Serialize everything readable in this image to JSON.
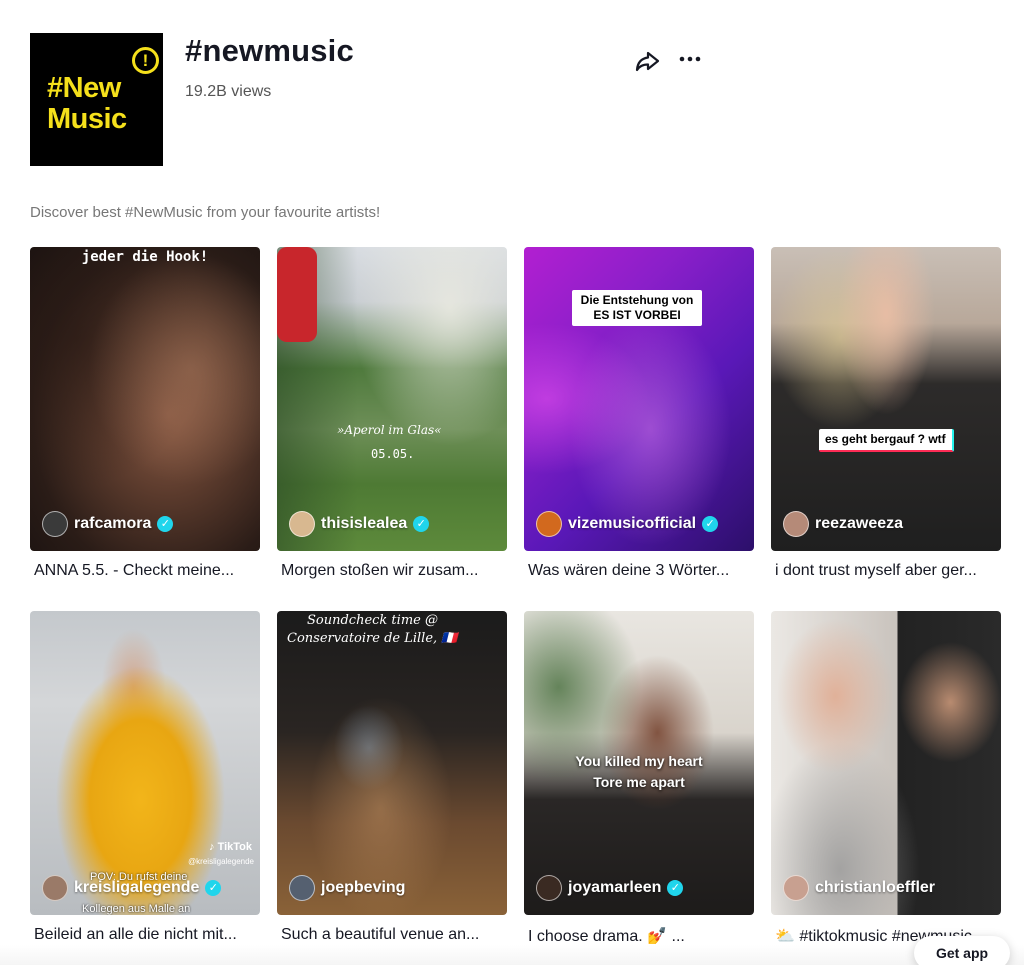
{
  "tag": {
    "title": "#newmusic",
    "views": "19.2B views",
    "description": "Discover best #NewMusic from your favourite artists!",
    "logo_lines": [
      "#New",
      "Music"
    ],
    "logo_badge": "!",
    "logo_colors": {
      "background": "#000000",
      "text": "#f5e01b"
    }
  },
  "actions": {
    "share_icon": "share-arrow-icon",
    "more_icon": "more-horizontal-icon"
  },
  "videos": [
    {
      "author": "rafcamora",
      "verified": true,
      "caption": "ANNA 5.5. - Checkt meine...",
      "overlay_text": "jeder die Hook!"
    },
    {
      "author": "thisislealea",
      "verified": true,
      "caption": "Morgen stoßen wir zusam...",
      "overlay_text": "»Aperol im Glas«",
      "overlay_sub": "05.05."
    },
    {
      "author": "vizemusicofficial",
      "verified": true,
      "caption": "Was wären deine 3 Wörter...",
      "overlay_text": "Die Entstehung von ES IST VORBEI"
    },
    {
      "author": "reezaweeza",
      "verified": false,
      "caption": "i dont trust myself aber ger...",
      "overlay_text": "es geht bergauf ? wtf"
    },
    {
      "author": "kreisligalegende",
      "verified": true,
      "caption": "Beileid an alle die nicht mit...",
      "overlay_text": "POV: Du rufst deine",
      "overlay_sub": "Kollegen aus Malle an",
      "watermark": "TikTok",
      "watermark_handle": "@kreisligalegende"
    },
    {
      "author": "joepbeving",
      "verified": false,
      "caption": "Such a beautiful venue an...",
      "overlay_text": "Soundcheck time @",
      "overlay_sub": "Conservatoire de Lille, 🇫🇷"
    },
    {
      "author": "joyamarleen",
      "verified": true,
      "caption": "I choose drama. 💅 ...",
      "overlay_text": "You killed my heart",
      "overlay_sub": "Tore me apart"
    },
    {
      "author": "christianloeffler",
      "verified": false,
      "caption": "⛅ #tiktokmusic #newmusic",
      "overlay_text": ""
    }
  ],
  "get_app": "Get app"
}
